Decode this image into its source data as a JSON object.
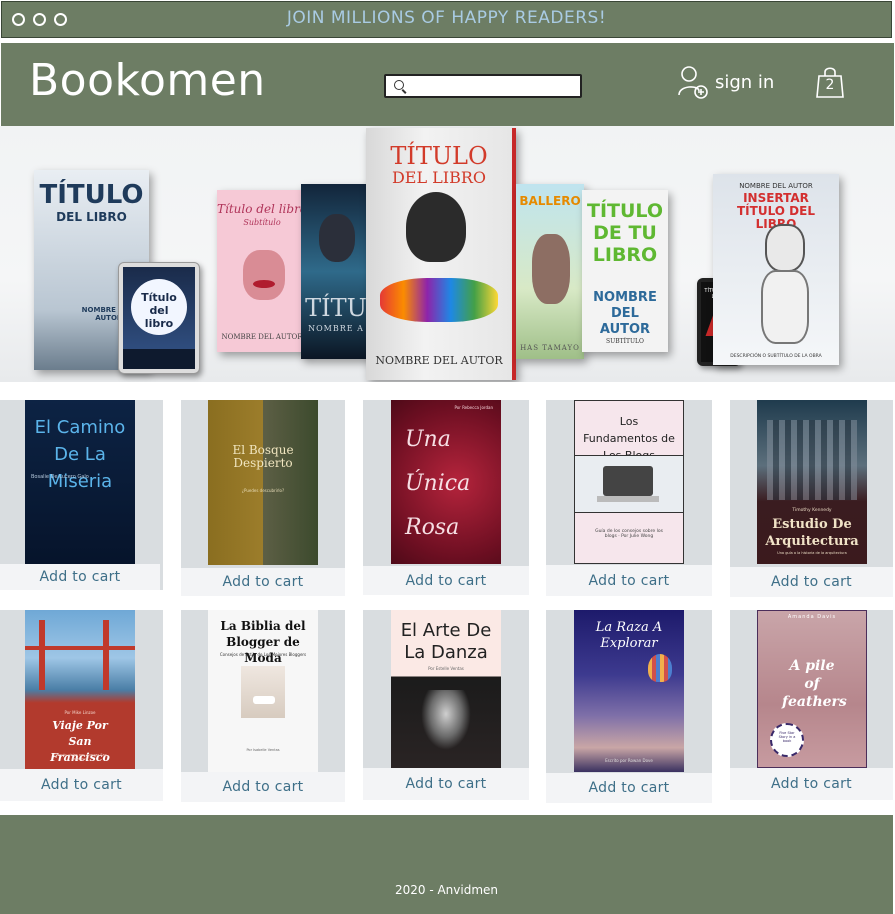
{
  "topbar": {
    "promo": "JOIN MILLIONS OF HAPPY READERS!"
  },
  "header": {
    "logo": "Bookomen",
    "search": {
      "placeholder": "",
      "value": ""
    },
    "signin_label": "sign in",
    "cart_count": "2"
  },
  "hero": {
    "books": [
      {
        "title_a": "TÍTULO",
        "title_b": "DEL LIBRO",
        "author": "NOMBRE DE LA AUTORA"
      },
      {
        "tablet": "Título del libro"
      },
      {
        "title": "Título del libro",
        "subtitle": "Subtítulo",
        "author": "NOMBRE DEL AUTOR"
      },
      {
        "title": "TÍTU",
        "author": "NOMBRE A"
      },
      {
        "title_a": "TÍTULO",
        "title_b": "DEL LIBRO",
        "author": "NOMBRE DEL AUTOR"
      },
      {
        "title": "BALLERO",
        "author": "HAS TAMAYO"
      },
      {
        "title": "TÍTULO DE TU LIBRO",
        "author": "NOMBRE DEL AUTOR",
        "subtitle": "SUBTÍTULO"
      },
      {
        "phone": "TÍTULO DEL LIBRO"
      },
      {
        "author": "NOMBRE DEL AUTOR",
        "title": "INSERTAR TÍTULO DEL LIBRO",
        "subtitle": "DESCRIPCIÓN O SUBTÍTULO DE LA OBRA"
      }
    ]
  },
  "products": [
    {
      "title": "El Camino De La Miseria",
      "author": "Bosalie De Lucero Galo",
      "add": "Add to cart"
    },
    {
      "title": "El Bosque Despierto",
      "author": "¿Puedes descubrirlo?",
      "add": "Add to cart"
    },
    {
      "title": "Una Única Rosa",
      "author": "Por Rebecca Jordan",
      "add": "Add to cart"
    },
    {
      "title": "Los Fundamentos de Los Blogs",
      "author": "Guía de los consejos sobre los blogs · Por Julie Wong",
      "add": "Add to cart"
    },
    {
      "title": "Estudio De Arquitectura",
      "author": "Timothy Kennedy",
      "subtitle": "Una guía a la historia de la arquitectura",
      "add": "Add to cart"
    },
    {
      "title": "Viaje Por San Francisco",
      "author": "Por Mike Linzoe",
      "subtitle": "Cuando viajes vas a gozar San Francisco",
      "add": "Add to cart"
    },
    {
      "title": "La Biblia del Blogger de Moda",
      "subtitle": "Consejos de Estilo de Los Mejores Bloggers",
      "author": "Por Isabelle Ventas",
      "add": "Add to cart"
    },
    {
      "title": "El Arte De La Danza",
      "author": "Por Estelle Ventas",
      "add": "Add to cart"
    },
    {
      "title": "La Raza A Explorar",
      "author": "Escrito por Rowan Dove",
      "add": "Add to cart"
    },
    {
      "title": "A pile of feathers",
      "author": "Amanda Davis",
      "badge": "Five Star Story in a book",
      "add": "Add to cart"
    }
  ],
  "footer": {
    "text": "2020 - Anvidmen"
  },
  "colors": {
    "brand": "#6d7d64",
    "accent_text": "#3e6f88",
    "promo": "#a9cbe3"
  }
}
